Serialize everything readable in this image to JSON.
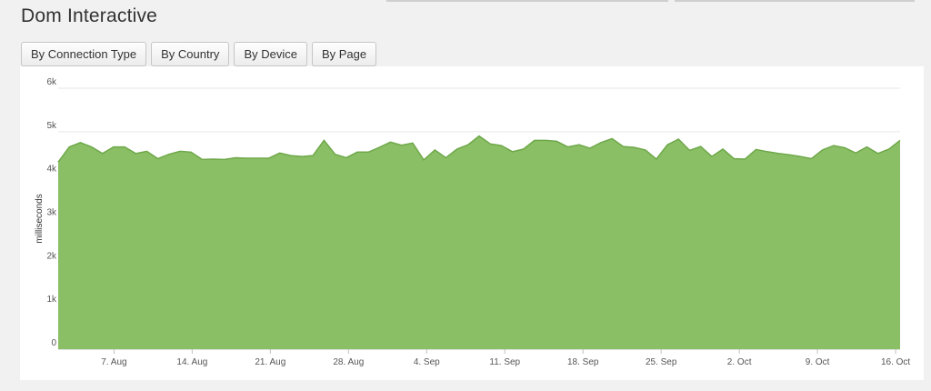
{
  "page": {
    "title": "Dom Interactive"
  },
  "tabs": [
    {
      "label": "By Connection Type"
    },
    {
      "label": "By Country"
    },
    {
      "label": "By Device"
    },
    {
      "label": "By Page"
    }
  ],
  "chart_data": {
    "type": "area",
    "title": "",
    "xlabel": "",
    "ylabel": "milliseconds",
    "ylim": [
      0,
      6000
    ],
    "y_ticks": [
      "0",
      "1k",
      "2k",
      "3k",
      "4k",
      "5k",
      "6k"
    ],
    "x_ticks": [
      {
        "label": "7. Aug",
        "x": 5
      },
      {
        "label": "14. Aug",
        "x": 12
      },
      {
        "label": "21. Aug",
        "x": 19
      },
      {
        "label": "28. Aug",
        "x": 26
      },
      {
        "label": "4. Sep",
        "x": 33
      },
      {
        "label": "11. Sep",
        "x": 40
      },
      {
        "label": "18. Sep",
        "x": 47
      },
      {
        "label": "25. Sep",
        "x": 54
      },
      {
        "label": "2. Oct",
        "x": 61
      },
      {
        "label": "9. Oct",
        "x": 68
      },
      {
        "label": "16. Oct",
        "x": 75
      }
    ],
    "grid": true,
    "legend": "none",
    "color": "#8bbf65",
    "stroke": "#6ea84a",
    "x_domain": [
      0,
      75.4
    ],
    "series": [
      {
        "values": [
          4300,
          4650,
          4750,
          4650,
          4500,
          4650,
          4650,
          4500,
          4550,
          4380,
          4480,
          4550,
          4530,
          4360,
          4370,
          4360,
          4400,
          4390,
          4390,
          4390,
          4510,
          4450,
          4430,
          4450,
          4800,
          4480,
          4400,
          4530,
          4530,
          4640,
          4760,
          4690,
          4740,
          4350,
          4580,
          4400,
          4600,
          4700,
          4900,
          4720,
          4680,
          4540,
          4600,
          4800,
          4800,
          4780,
          4650,
          4700,
          4620,
          4750,
          4840,
          4660,
          4640,
          4580,
          4370,
          4700,
          4830,
          4570,
          4660,
          4430,
          4600,
          4380,
          4370,
          4590,
          4540,
          4500,
          4470,
          4430,
          4380,
          4580,
          4680,
          4630,
          4510,
          4650,
          4500,
          4600,
          4800
        ]
      }
    ]
  }
}
